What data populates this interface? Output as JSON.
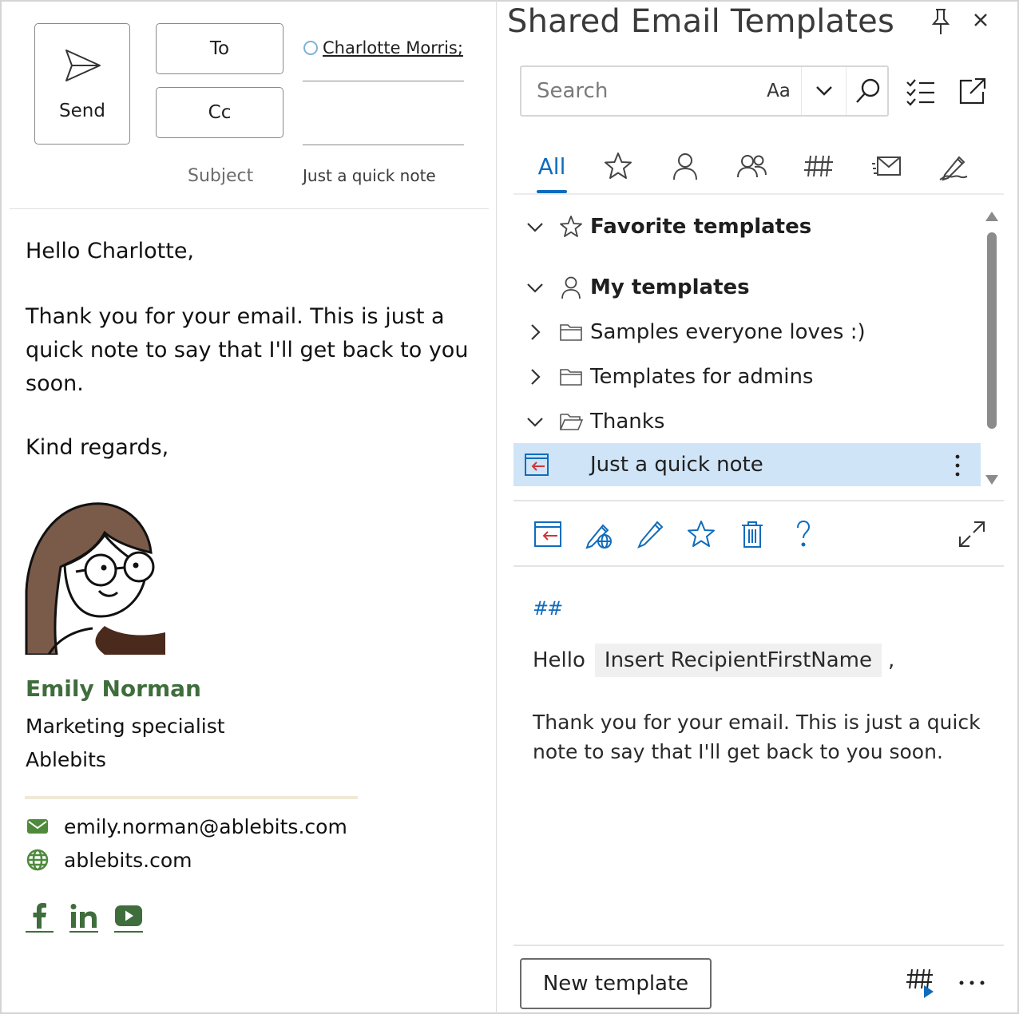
{
  "compose": {
    "send_label": "Send",
    "to_label": "To",
    "cc_label": "Cc",
    "recipient": "Charlotte Morris;",
    "subject_label": "Subject",
    "subject_value": "Just a quick note",
    "body": {
      "greeting": "Hello Charlotte,",
      "paragraph": "Thank you for your email. This is just a quick note to say that I'll get back to you soon.",
      "regards": "Kind regards,"
    },
    "signature": {
      "name": "Emily Norman",
      "title": "Marketing specialist",
      "company": "Ablebits",
      "email": "emily.norman@ablebits.com",
      "website": "ablebits.com",
      "name_color": "#3f6d3c",
      "social": [
        "facebook-icon",
        "linkedin-icon",
        "youtube-icon"
      ]
    }
  },
  "pane": {
    "title": "Shared Email Templates",
    "search": {
      "placeholder": "Search",
      "match_case_label": "Aa"
    },
    "tabs": {
      "active_label": "All",
      "icons": [
        "star-icon",
        "person-icon",
        "people-icon",
        "macro-hash-icon",
        "envelope-icon",
        "signature-pen-icon"
      ]
    },
    "tree": {
      "favorites": "Favorite templates",
      "my_templates": "My templates",
      "folders": [
        "Samples everyone loves :)",
        "Templates for admins",
        "Thanks"
      ],
      "selected_template": "Just a quick note"
    },
    "preview": {
      "macro_marker": "##",
      "hello": "Hello",
      "macro_field": "Insert RecipientFirstName",
      "comma": ",",
      "paragraph": "Thank you for your email. This is just a quick note to say that I'll get back to you soon."
    },
    "footer": {
      "new_template_label": "New template"
    },
    "colors": {
      "accent": "#0f6cbd",
      "selected_row": "#cfe4f6",
      "insert_arrow": "#d13438"
    }
  }
}
